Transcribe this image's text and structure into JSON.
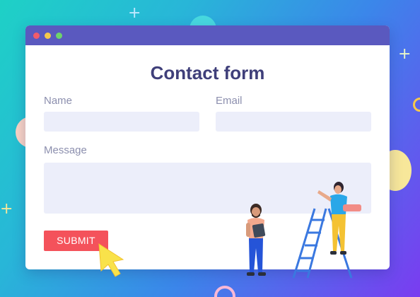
{
  "form": {
    "title": "Contact form",
    "name_label": "Name",
    "email_label": "Email",
    "message_label": "Message",
    "name_value": "",
    "email_value": "",
    "message_value": "",
    "submit_label": "SUBMIT"
  },
  "window": {
    "controls": [
      "close",
      "minimize",
      "maximize"
    ]
  },
  "colors": {
    "titlebar": "#5a59bf",
    "title_text": "#3f3f7a",
    "label_text": "#8c8fae",
    "field_bg": "#eceefa",
    "submit_bg": "#f4525b",
    "dot_red": "#f25b6a",
    "dot_yellow": "#f5c84c",
    "dot_green": "#6ed36b"
  },
  "illustrations": [
    "man-with-clipboard",
    "woman-on-ladder",
    "arrow-cursor"
  ]
}
